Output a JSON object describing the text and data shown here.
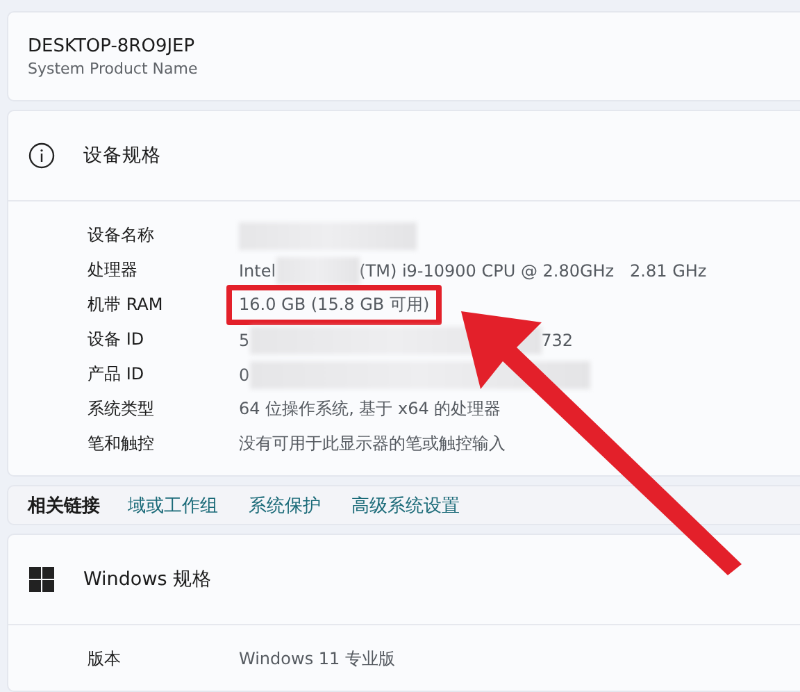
{
  "device": {
    "name": "DESKTOP-8RO9JEP",
    "model": "System Product Name"
  },
  "device_specs": {
    "title": "设备规格",
    "rows": [
      {
        "label": "设备名称",
        "highlighted": false,
        "parts": [
          {
            "kind": "redacted"
          }
        ]
      },
      {
        "label": "处理器",
        "highlighted": false,
        "parts": [
          {
            "kind": "text",
            "text": "Intel"
          },
          {
            "kind": "redacted"
          },
          {
            "kind": "text",
            "text": "(TM) i9-10900 CPU @ 2.80GHz   2.81 GHz"
          }
        ]
      },
      {
        "label": "机带 RAM",
        "highlighted": true,
        "parts": [
          {
            "kind": "text",
            "text": "16.0 GB (15.8 GB 可用)"
          }
        ]
      },
      {
        "label": "设备 ID",
        "highlighted": false,
        "parts": [
          {
            "kind": "text",
            "text": "5"
          },
          {
            "kind": "redacted"
          },
          {
            "kind": "text",
            "text": "732"
          }
        ]
      },
      {
        "label": "产品 ID",
        "highlighted": false,
        "parts": [
          {
            "kind": "text",
            "text": "0"
          },
          {
            "kind": "redacted"
          }
        ]
      },
      {
        "label": "系统类型",
        "highlighted": false,
        "parts": [
          {
            "kind": "text",
            "text": "64 位操作系统, 基于 x64 的处理器"
          }
        ]
      },
      {
        "label": "笔和触控",
        "highlighted": false,
        "parts": [
          {
            "kind": "text",
            "text": "没有可用于此显示器的笔或触控输入"
          }
        ]
      }
    ]
  },
  "related_links": {
    "title": "相关链接",
    "links": [
      "域或工作组",
      "系统保护",
      "高级系统设置"
    ]
  },
  "windows_specs": {
    "title": "Windows 规格",
    "rows": [
      {
        "label": "版本",
        "highlighted": false,
        "parts": [
          {
            "kind": "text",
            "text": "Windows 11 专业版"
          }
        ]
      }
    ]
  }
}
